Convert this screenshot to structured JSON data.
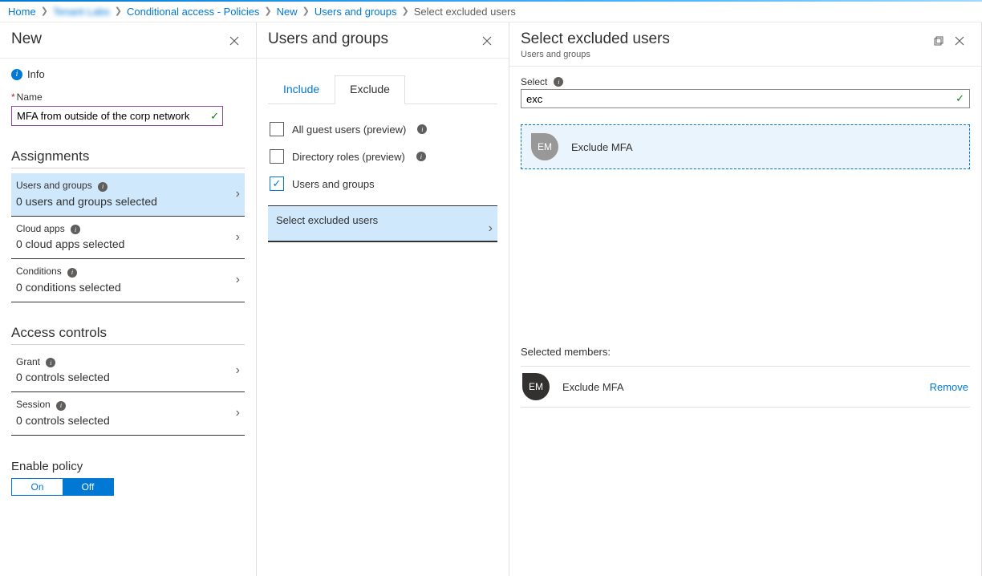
{
  "breadcrumb": {
    "home": "Home",
    "org": "Tenant Labs",
    "policies": "Conditional access - Policies",
    "new": "New",
    "users_groups": "Users and groups",
    "current": "Select excluded users"
  },
  "new_blade": {
    "title": "New",
    "info_label": "Info",
    "name_label": "Name",
    "name_value": "MFA from outside of the corp network",
    "assignments_heading": "Assignments",
    "assignments": {
      "users_groups": {
        "title": "Users and groups",
        "sub": "0 users and groups selected"
      },
      "cloud_apps": {
        "title": "Cloud apps",
        "sub": "0 cloud apps selected"
      },
      "conditions": {
        "title": "Conditions",
        "sub": "0 conditions selected"
      }
    },
    "access_controls_heading": "Access controls",
    "access_controls": {
      "grant": {
        "title": "Grant",
        "sub": "0 controls selected"
      },
      "session": {
        "title": "Session",
        "sub": "0 controls selected"
      }
    },
    "enable_policy_label": "Enable policy",
    "toggle_on": "On",
    "toggle_off": "Off"
  },
  "ug_blade": {
    "title": "Users and groups",
    "tabs": {
      "include": "Include",
      "exclude": "Exclude"
    },
    "opts": {
      "all_guest": "All guest users (preview)",
      "directory_roles": "Directory roles (preview)",
      "users_groups": "Users and groups"
    },
    "select_excluded": "Select excluded users"
  },
  "sel_blade": {
    "title": "Select excluded users",
    "subtitle": "Users and groups",
    "select_label": "Select",
    "search_value": "exc",
    "result": {
      "initials": "EM",
      "name": "Exclude MFA"
    },
    "selected_heading": "Selected members:",
    "selected": {
      "initials": "EM",
      "name": "Exclude MFA"
    },
    "remove": "Remove"
  }
}
